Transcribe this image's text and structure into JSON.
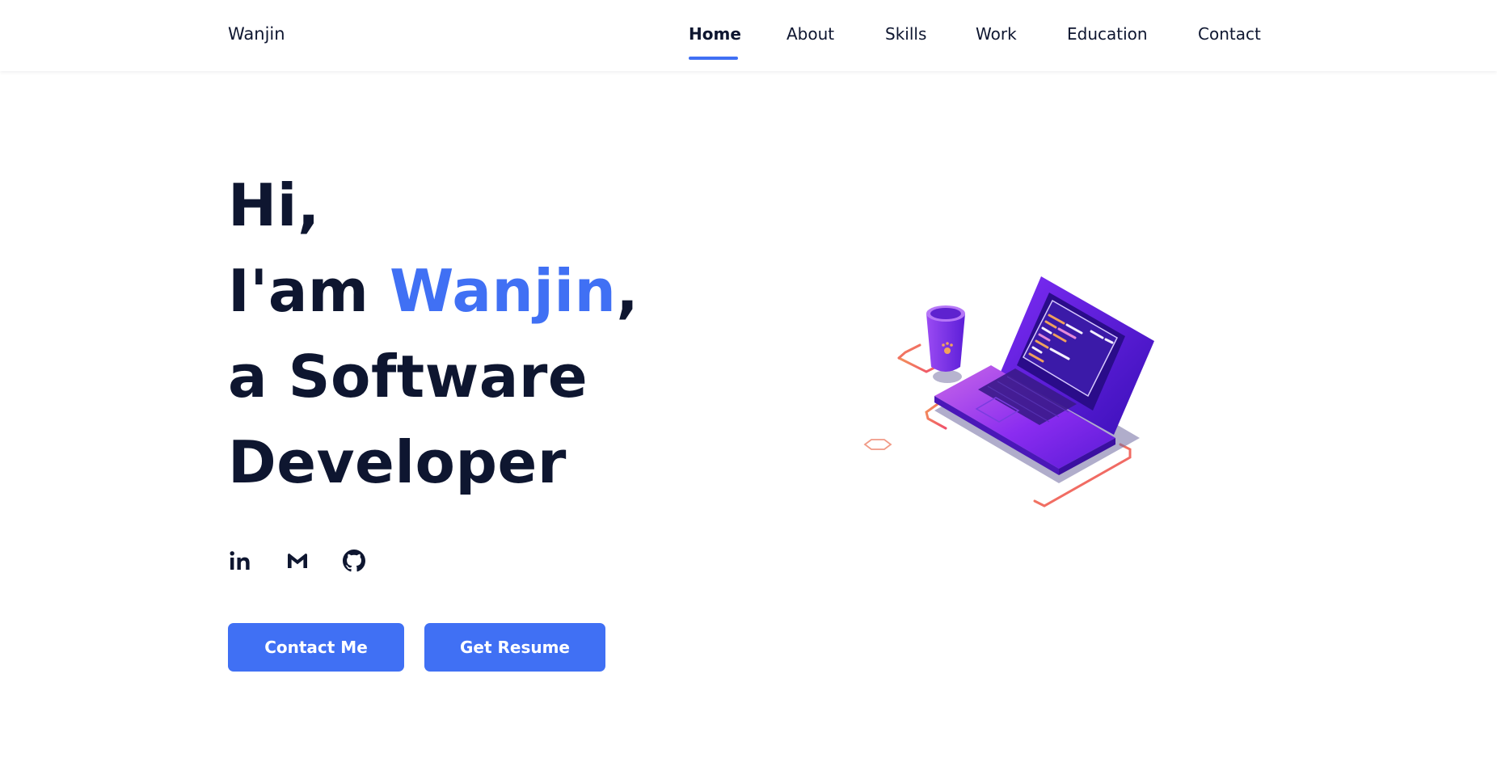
{
  "header": {
    "logo": "Wanjin",
    "nav": [
      {
        "label": "Home",
        "active": true
      },
      {
        "label": "About",
        "active": false
      },
      {
        "label": "Skills",
        "active": false
      },
      {
        "label": "Work",
        "active": false
      },
      {
        "label": "Education",
        "active": false
      },
      {
        "label": "Contact",
        "active": false
      }
    ]
  },
  "hero": {
    "line1": "Hi,",
    "line2_prefix": "I'am ",
    "line2_name": "Wanjin",
    "line2_suffix": ",",
    "line3": "a Software",
    "line4": "Developer"
  },
  "social": [
    {
      "icon": "linkedin-icon"
    },
    {
      "icon": "gmail-icon"
    },
    {
      "icon": "github-icon"
    }
  ],
  "buttons": {
    "contact": "Contact Me",
    "resume": "Get Resume"
  },
  "illustration": {
    "icon": "laptop-coffee-illustration"
  },
  "colors": {
    "accent": "#4070f4",
    "text": "#0e1630",
    "background": "#ffffff"
  }
}
